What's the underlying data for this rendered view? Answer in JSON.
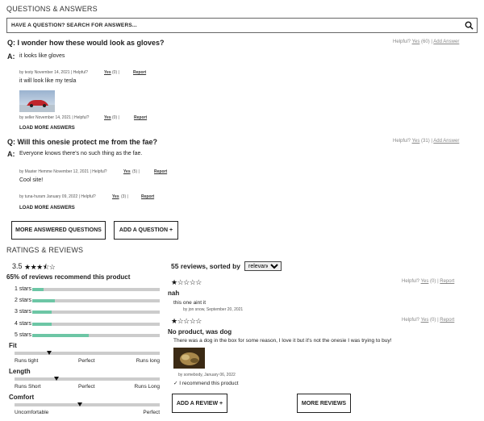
{
  "qa": {
    "title": "QUESTIONS & ANSWERS",
    "search_placeholder": "HAVE A QUESTION? SEARCH FOR ANSWERS...",
    "questions": [
      {
        "q": "Q: I wonder how these would look as gloves?",
        "helpful_label": "Helpful?",
        "yes_label": "Yes",
        "yes_count": "(60)",
        "sep": "|",
        "add_answer": "Add Answer",
        "answers": [
          {
            "text": "it looks like gloves",
            "by": "by testy November 14, 2021 | Helpful?",
            "yes": "Yes",
            "count": "(0)",
            "sep": "|",
            "report": "Report"
          },
          {
            "text": "it will look like my tesla",
            "by": "by seller November 14, 2021 | Helpful?",
            "yes": "Yes",
            "count": "(0)",
            "sep": "|",
            "report": "Report"
          }
        ],
        "load_more": "LOAD MORE ANSWERS"
      },
      {
        "q": "Q: Will this onesie protect me from the fae?",
        "helpful_label": "Helpful?",
        "yes_label": "Yes",
        "yes_count": "(31)",
        "sep": "|",
        "add_answer": "Add Answer",
        "answers": [
          {
            "text": "Everyone knows there's no such thing as the fae.",
            "by": "by Master Hemme November 12, 2021 | Helpful?",
            "yes": "Yes",
            "count": "(5)",
            "sep": "|",
            "report": "Report"
          },
          {
            "text": "Cool site!",
            "by": "by tuna-huram January 09, 2022 | Helpful?",
            "yes": "Yes",
            "count": "(3)",
            "sep": "|",
            "report": "Report"
          }
        ],
        "load_more": "LOAD MORE ANSWERS"
      }
    ],
    "a_label": "A:",
    "more_questions_btn": "MORE ANSWERED QUESTIONS",
    "add_question_btn": "ADD A QUESTION +"
  },
  "ratings": {
    "title": "RATINGS & REVIEWS",
    "avg": "3.5",
    "avg_stars": "★★★⯪☆",
    "recommend": "65% of reviews recommend this product",
    "bars": [
      {
        "label": "1 stars",
        "fill": 0.09
      },
      {
        "label": "2 stars",
        "fill": 0.18
      },
      {
        "label": "3 stars",
        "fill": 0.15
      },
      {
        "label": "4 stars",
        "fill": 0.15
      },
      {
        "label": "5 stars",
        "fill": 0.44
      }
    ],
    "characteristics": [
      {
        "name": "Fit",
        "low": "Runs tight",
        "mid": "Perfect",
        "high": "Runs long",
        "pos": 0.24
      },
      {
        "name": "Length",
        "low": "Runs Short",
        "mid": "Perfect",
        "high": "Runs Long",
        "pos": 0.29
      },
      {
        "name": "Comfort",
        "low": "Uncomfortable",
        "mid": "",
        "high": "Perfect",
        "pos": 0.45
      }
    ]
  },
  "reviews": {
    "count_text": "55 reviews, sorted by",
    "sort_value": "relevance",
    "items": [
      {
        "stars": "★☆☆☆☆",
        "helpful": "Helpful?",
        "yes": "Yes",
        "count": "(0)",
        "sep": "|",
        "report": "Report",
        "title": "nah",
        "body": "this one aint it",
        "by": "by jon snow, September 20, 2021"
      },
      {
        "stars": "★☆☆☆☆",
        "helpful": "Helpful?",
        "yes": "Yes",
        "count": "(0)",
        "sep": "|",
        "report": "Report",
        "title": "No product, was dog",
        "body": "There was a dog in the box for some reason, I love it but it's not the onesie I was trying to buy!",
        "by": "by somebody, January 06, 2022",
        "recommend": "✓ I recommend this product"
      }
    ],
    "add_review_btn": "ADD A REVIEW +",
    "more_reviews_btn": "MORE REVIEWS"
  }
}
